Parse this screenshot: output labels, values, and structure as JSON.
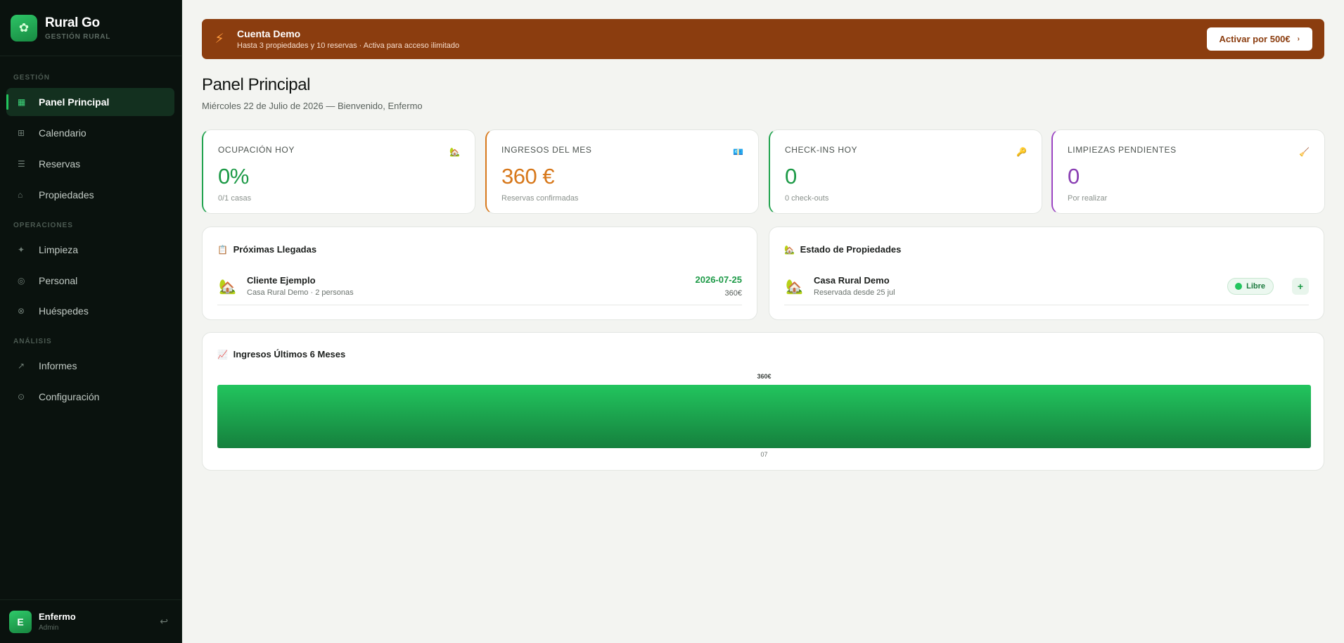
{
  "brand": {
    "name": "Rural Go",
    "subtitle": "GESTIÓN RURAL",
    "logo_icon": "leaf-icon"
  },
  "sidebar": {
    "sections": [
      {
        "label": "GESTIÓN"
      },
      {
        "label": "OPERACIONES"
      },
      {
        "label": "ANÁLISIS"
      }
    ],
    "items": [
      {
        "label": "Panel Principal",
        "icon": "grid-icon",
        "glyph": "▦",
        "active": true
      },
      {
        "label": "Calendario",
        "icon": "calendar-icon",
        "glyph": "⊞"
      },
      {
        "label": "Reservas",
        "icon": "list-icon",
        "glyph": "☰"
      },
      {
        "label": "Propiedades",
        "icon": "home-icon",
        "glyph": "⌂"
      },
      {
        "label": "Limpieza",
        "icon": "sparkle-icon",
        "glyph": "✦"
      },
      {
        "label": "Personal",
        "icon": "person-icon",
        "glyph": "◎"
      },
      {
        "label": "Huéspedes",
        "icon": "guests-icon",
        "glyph": "⊗"
      },
      {
        "label": "Informes",
        "icon": "trend-icon",
        "glyph": "↗"
      },
      {
        "label": "Configuración",
        "icon": "settings-icon",
        "glyph": "⊙"
      }
    ]
  },
  "user": {
    "initial": "E",
    "name": "Enfermo",
    "role": "Admin",
    "logout_glyph": "↩"
  },
  "banner": {
    "icon": "bolt-icon",
    "glyph": "⚡",
    "title": "Cuenta Demo",
    "subtitle": "Hasta 3 propiedades y 10 reservas · Activa para acceso ilimitado",
    "button_label": "Activar por 500€",
    "button_chevron": "›"
  },
  "page": {
    "title": "Panel Principal",
    "subtitle": "Miércoles 22 de Julio de 2026 — Bienvenido, Enfermo"
  },
  "stats": [
    {
      "label": "OCUPACIÓN HOY",
      "value": "0%",
      "hint": "0/1 casas",
      "icon": "house-icon",
      "glyph": "🏡",
      "color": "#1d9a47"
    },
    {
      "label": "INGRESOS DEL MES",
      "value": "360 €",
      "hint": "Reservas confirmadas",
      "icon": "money-icon",
      "glyph": "💶",
      "color": "#d7781b"
    },
    {
      "label": "CHECK-INS HOY",
      "value": "0",
      "hint": "0 check-outs",
      "icon": "key-icon",
      "glyph": "🔑",
      "color": "#1d9a47"
    },
    {
      "label": "LIMPIEZAS PENDIENTES",
      "value": "0",
      "hint": "Por realizar",
      "icon": "broom-icon",
      "glyph": "🧹",
      "color": "#8a3fb3"
    }
  ],
  "arrivals": {
    "title": "Próximas Llegadas",
    "title_glyph": "📋",
    "title_icon": "clipboard-icon",
    "rows": [
      {
        "name": "Cliente Ejemplo",
        "detail": "Casa Rural Demo · 2 personas",
        "date": "2026-07-25",
        "amount": "360€",
        "glyph": "🏡"
      }
    ]
  },
  "properties": {
    "title": "Estado de Propiedades",
    "title_glyph": "🏡",
    "title_icon": "house-icon",
    "rows": [
      {
        "name": "Casa Rural Demo",
        "detail": "Reservada desde 25 jul",
        "status": "Libre",
        "action": "+",
        "glyph": "🏡"
      }
    ]
  },
  "revenue": {
    "title": "Ingresos Últimos 6 Meses",
    "title_glyph": "📈",
    "title_icon": "chart-icon"
  },
  "chart_data": {
    "type": "bar",
    "categories": [
      "07"
    ],
    "values": [
      360
    ],
    "data_labels": [
      "360€"
    ],
    "color_top": "#22c55e",
    "color_bottom": "#15803d",
    "grid": false,
    "legend": "none"
  }
}
